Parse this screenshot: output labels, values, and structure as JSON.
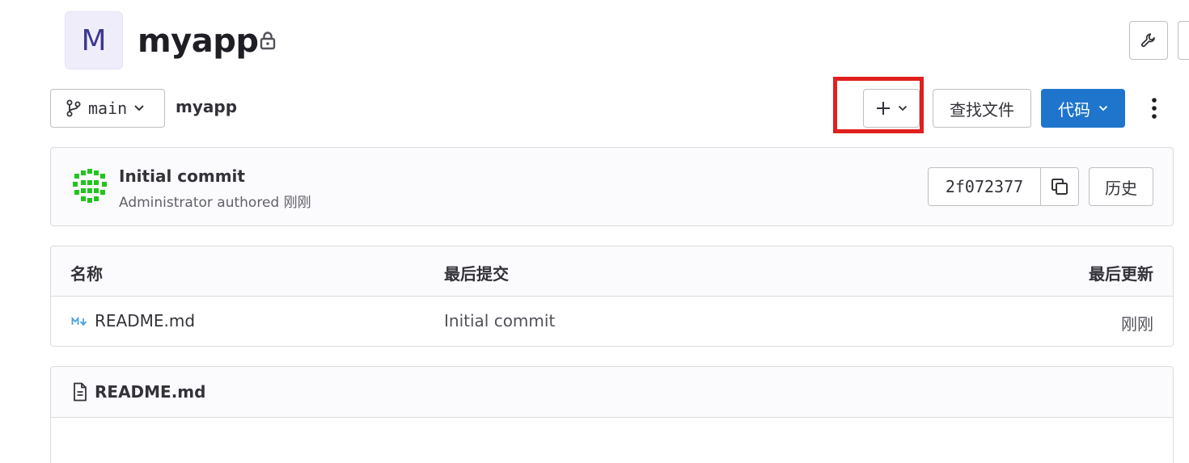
{
  "project": {
    "avatar_letter": "M",
    "name": "myapp"
  },
  "toolbar": {
    "branch": "main",
    "breadcrumb": "myapp",
    "add_label": "+",
    "find_file": "查找文件",
    "code": "代码"
  },
  "commit": {
    "title": "Initial commit",
    "author_line": "Administrator authored 刚刚",
    "sha": "2f072377",
    "history": "历史"
  },
  "file_table": {
    "headers": [
      "名称",
      "最后提交",
      "最后更新"
    ],
    "rows": [
      {
        "name": "README.md",
        "last_commit": "Initial commit",
        "last_update": "刚刚"
      }
    ]
  },
  "readme": {
    "title": "README.md"
  },
  "colors": {
    "primary": "#1f75cb",
    "highlight": "#e0201e",
    "avatar_bg": "#f0edfb",
    "identicon": "#1aaa55"
  }
}
